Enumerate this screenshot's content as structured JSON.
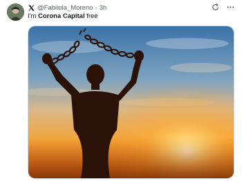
{
  "tweet": {
    "handle": "@Fabiiola_Moreno",
    "separator": "·",
    "time": "3h",
    "text_prefix": "I'm ",
    "text_bold": "Corona Capital",
    "text_suffix": " free"
  },
  "icons": {
    "platform": "x-logo-icon",
    "refresh": "grok-refresh-icon",
    "more": "more-options-icon"
  },
  "media": {
    "subject": "silhouette-breaking-chains-sunset-image"
  }
}
